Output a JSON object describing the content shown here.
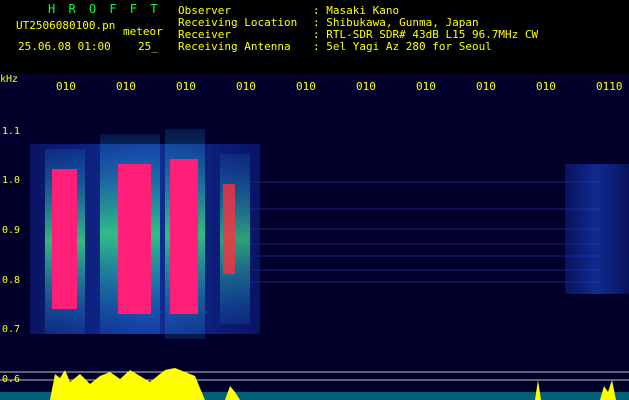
{
  "header": {
    "brand": "H R O F F T",
    "filename": "UT2506080100.pn",
    "type": "meteor",
    "datetime": "25.06.08 01:00",
    "frame": "25_"
  },
  "meta": [
    {
      "key": "Observer",
      "value": ": Masaki Kano"
    },
    {
      "key": "Receiving Location",
      "value": ": Shibukawa, Gunma, Japan"
    },
    {
      "key": "Receiver",
      "value": ": RTL-SDR SDR# 43dB L15 96.7MHz CW"
    },
    {
      "key": "Receiving Antenna",
      "value": ": 5el Yagi Az 280 for Seoul"
    }
  ],
  "axis": {
    "unit": "kHz",
    "y_ticks": [
      "1.1",
      "1.0",
      "0.9",
      "0.8",
      "0.7",
      "0.6"
    ],
    "time_labels": [
      "010",
      "010",
      "010",
      "010",
      "010",
      "010",
      "010",
      "010",
      "010",
      "0110"
    ]
  },
  "colors": {
    "text": "#ffff00",
    "brand": "#00ff40",
    "background": "#000000",
    "echo_core": "#ff1e78",
    "noise": "#1030d0"
  }
}
